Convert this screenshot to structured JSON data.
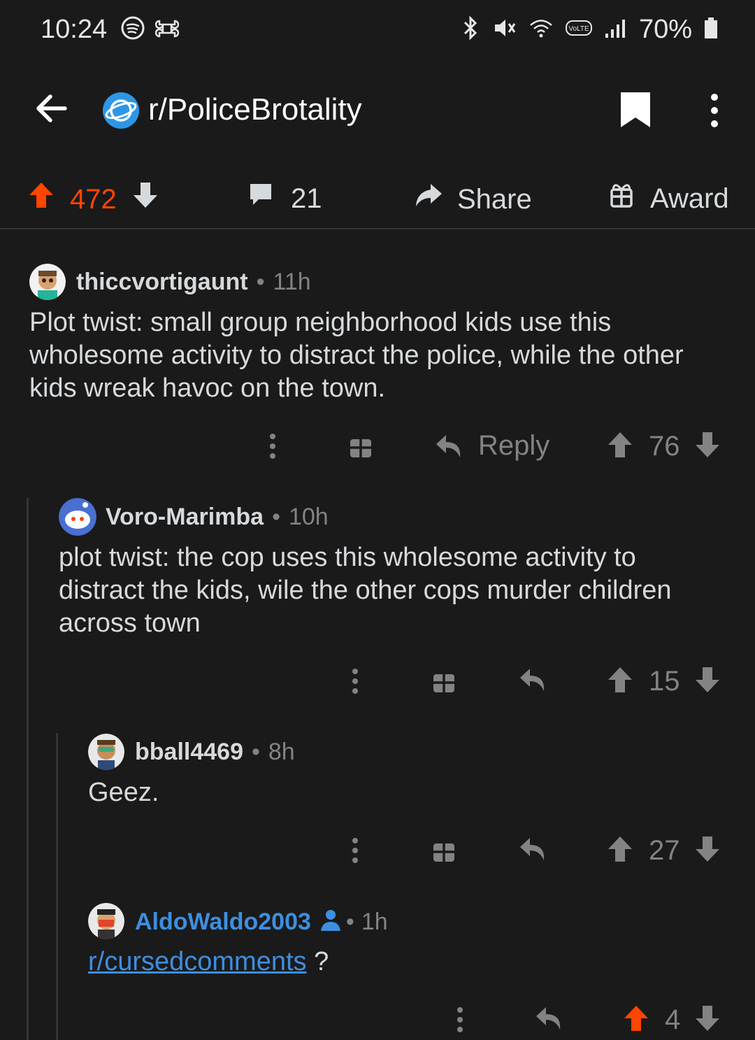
{
  "status": {
    "time": "10:24",
    "battery": "70%"
  },
  "header": {
    "subreddit": "r/PoliceBrotality"
  },
  "post_actions": {
    "votes": "472",
    "comments": "21",
    "share": "Share",
    "award": "Award"
  },
  "comments": [
    {
      "user": "thiccvortigaunt",
      "sep": "•",
      "age": "11h",
      "lines": [
        "Plot twist: small group neighborhood kids use this",
        "wholesome activity to distract the police, while the other",
        "kids wreak havoc on the town."
      ],
      "reply": "Reply",
      "score": "76"
    },
    {
      "user": "Voro-Marimba",
      "sep": "•",
      "age": "10h",
      "lines": [
        "plot twist: the cop uses this wholesome activity to",
        "distract the kids, wile the other cops murder children",
        "across town"
      ],
      "score": "15"
    },
    {
      "user": "bball4469",
      "sep": "•",
      "age": "8h",
      "lines": [
        "Geez."
      ],
      "score": "27"
    },
    {
      "user": "AldoWaldo2003",
      "sep": "•",
      "age": "1h",
      "link": "r/cursedcomments",
      "suffix": " ?",
      "score": "4"
    }
  ],
  "colors": {
    "background": "#1a1a1b",
    "upvote": "#ff4500",
    "link": "#3d8fe0",
    "muted": "#818384"
  }
}
